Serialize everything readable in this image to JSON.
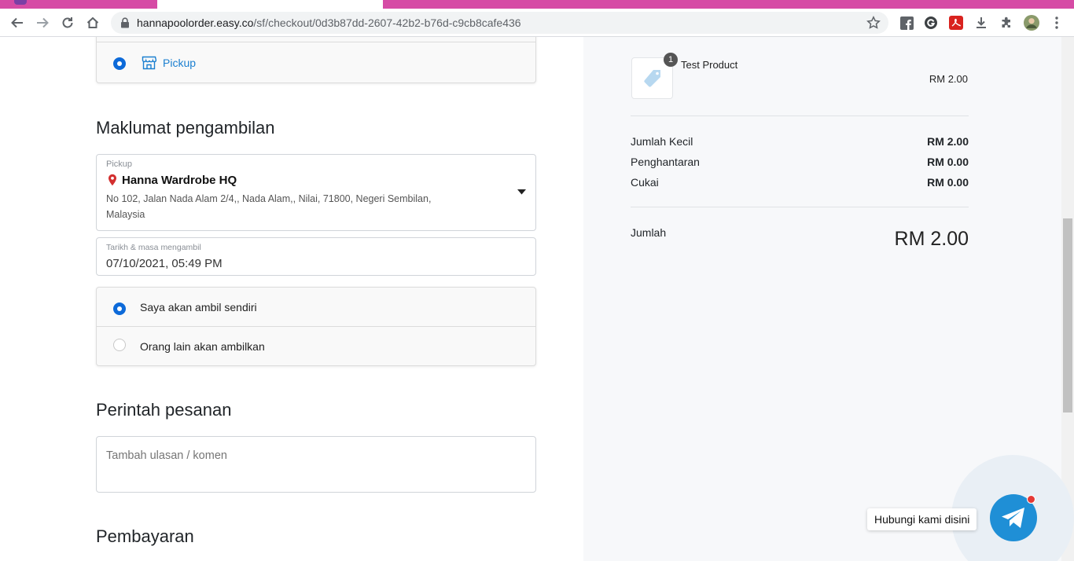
{
  "browser": {
    "url_host": "hannapoolorder.easy.co",
    "url_path": "/sf/checkout/0d3b87dd-2607-42b2-b76d-c9cb8cafe436"
  },
  "delivery": {
    "pickup_option_label": "Pickup"
  },
  "pickup_info": {
    "title": "Maklumat pengambilan",
    "location_field_label": "Pickup",
    "location_name": "Hanna Wardrobe HQ",
    "address_line1": "No 102, Jalan Nada Alam 2/4,, Nada Alam,, Nilai, 71800, Negeri Sembilan,",
    "address_line2": "Malaysia",
    "datetime_label": "Tarikh & masa mengambil",
    "datetime_value": "07/10/2021, 05:49 PM",
    "self_pickup_label": "Saya akan ambil sendiri",
    "other_pickup_label": "Orang lain akan ambilkan"
  },
  "order_notes": {
    "title": "Perintah pesanan",
    "placeholder": "Tambah ulasan / komen"
  },
  "payment": {
    "title": "Pembayaran"
  },
  "summary": {
    "product_name": "Test Product",
    "product_qty": "1",
    "product_price": "RM 2.00",
    "subtotal_label": "Jumlah Kecil",
    "subtotal_value": "RM 2.00",
    "shipping_label": "Penghantaran",
    "shipping_value": "RM 0.00",
    "tax_label": "Cukai",
    "tax_value": "RM 0.00",
    "total_label": "Jumlah",
    "total_value": "RM 2.00"
  },
  "chat": {
    "tooltip": "Hubungi kami disini"
  },
  "colors": {
    "accent": "#0d6ad9",
    "tab_bar": "#d64ba5",
    "chat": "#1f8fd6",
    "pin": "#d32f2f"
  }
}
